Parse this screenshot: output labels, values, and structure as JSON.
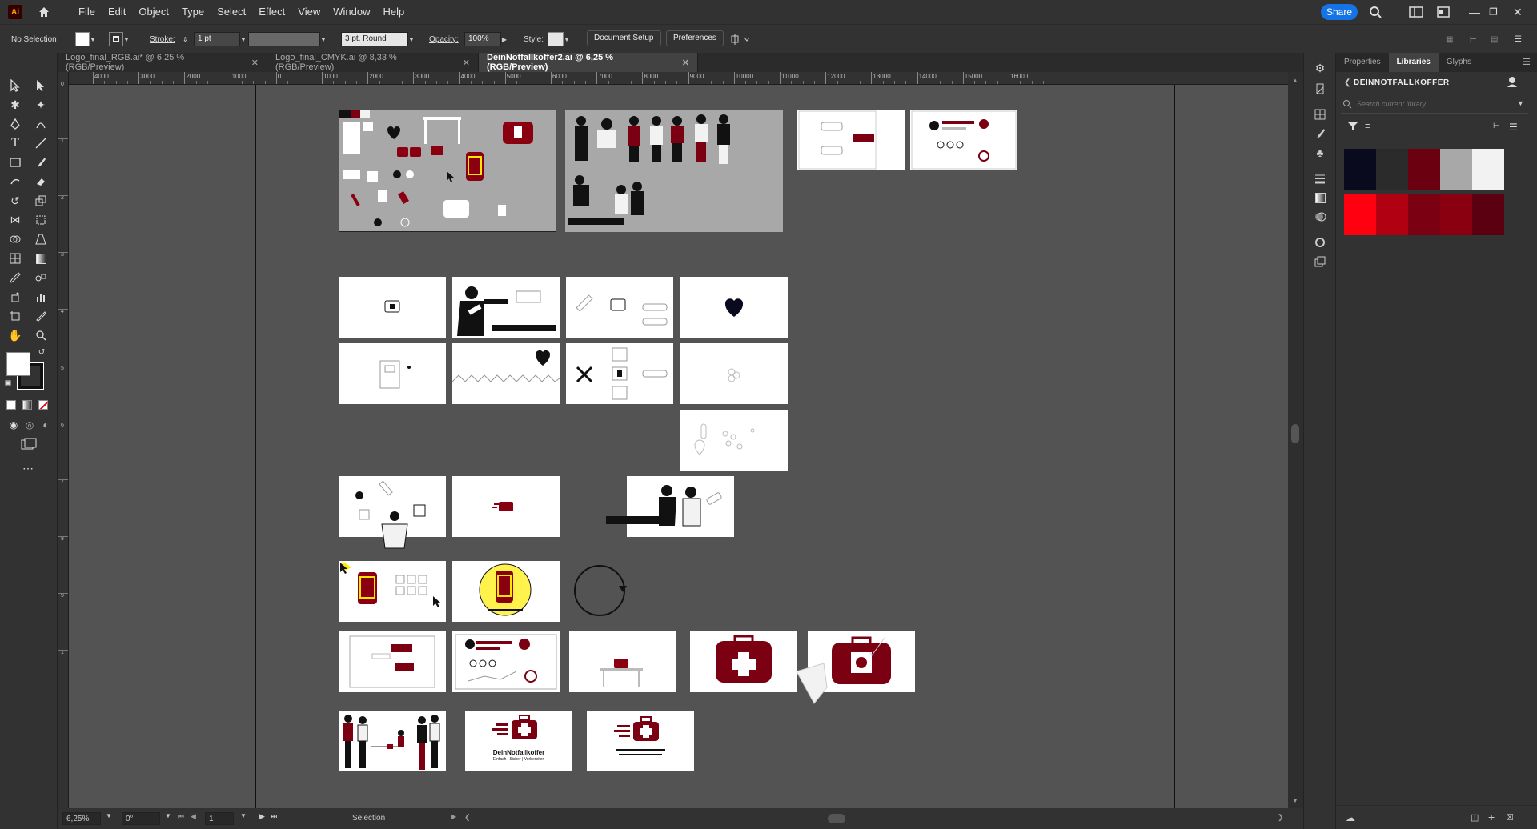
{
  "app": {
    "logo": "Ai",
    "share_label": "Share"
  },
  "menu": [
    "File",
    "Edit",
    "Object",
    "Type",
    "Select",
    "Effect",
    "View",
    "Window",
    "Help"
  ],
  "control_bar": {
    "selection": "No Selection",
    "stroke_label": "Stroke:",
    "stroke_value": "1 pt",
    "brush": "3 pt. Round",
    "opacity_label": "Opacity:",
    "opacity_value": "100%",
    "style_label": "Style:",
    "document_setup": "Document Setup",
    "preferences": "Preferences"
  },
  "tabs": [
    {
      "label": "Logo_final_RGB.ai* @ 6,25 % (RGB/Preview)",
      "active": false
    },
    {
      "label": "Logo_final_CMYK.ai @ 8,33 % (RGB/Preview)",
      "active": false
    },
    {
      "label": "DeinNotfallkoffer2.ai @ 6,25 % (RGB/Preview)",
      "active": true
    }
  ],
  "ruler_h_ticks": [
    "4000",
    "3000",
    "2000",
    "1000",
    "0",
    "1000",
    "2000",
    "3000",
    "4000",
    "5000",
    "6000",
    "7000",
    "8000",
    "9000",
    "10000",
    "11000",
    "12000",
    "13000",
    "14000",
    "15000",
    "16000"
  ],
  "ruler_v_ticks": [
    "0",
    "1",
    "2",
    "3",
    "4",
    "5",
    "6",
    "7",
    "8",
    "9",
    "1"
  ],
  "status": {
    "zoom": "6,25%",
    "rotation": "0°",
    "artboard": "1",
    "mode": "Selection"
  },
  "panel": {
    "tabs": [
      "Properties",
      "Libraries",
      "Glyphs"
    ],
    "active_tab": "Libraries",
    "library_name": "DEINNOTFALLKOFFER",
    "search_placeholder": "Search current library"
  },
  "swatches_row1": [
    "#0a0a1e",
    "#2b2b2b",
    "#6b0010",
    "#a8a8a8",
    "#f2f2f2"
  ],
  "swatches_row2": [
    "#ff0010",
    "#b00012",
    "#7a0012",
    "#8a0010",
    "#5a0010"
  ],
  "artboard_texts": {
    "brand_name": "DeinNotfallkoffer",
    "brand_tagline": "Einfach | Sicher | Vorbereiten"
  }
}
